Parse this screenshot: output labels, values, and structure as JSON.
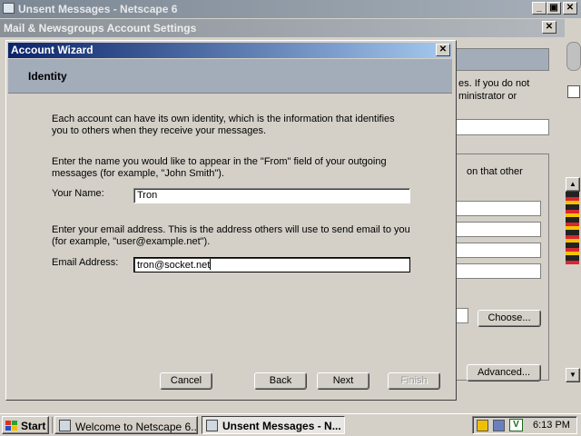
{
  "netscape_window": {
    "title": "Unsent Messages - Netscape 6",
    "controls": {
      "minimize": "_",
      "maximize": "▣",
      "close": "✕"
    }
  },
  "account_settings": {
    "title": "Mail & Newsgroups Account Settings",
    "close": "✕",
    "fragments": {
      "line1": "es. If you do not",
      "line2": "ministrator or",
      "line3": "on that other"
    },
    "choose_button": "Choose...",
    "advanced_button": "Advanced..."
  },
  "wizard": {
    "title": "Account Wizard",
    "close": "✕",
    "header": "Identity",
    "intro_line1": "Each account can have its own identity, which is the information that identifies",
    "intro_line2": "you to others when they receive your messages.",
    "name_help_line1": "Enter the name you would like to appear in the \"From\" field of your outgoing",
    "name_help_line2": "messages (for example, \"John Smith\").",
    "name_label": "Your Name:",
    "name_value": "Tron",
    "email_help_line1": "Enter your email address. This is the address others will use to send email to you",
    "email_help_line2": "(for example, \"user@example.net\").",
    "email_label": "Email Address:",
    "email_value": "tron@socket.net",
    "buttons": {
      "cancel": "Cancel",
      "back": "Back",
      "next": "Next",
      "finish": "Finish"
    }
  },
  "taskbar": {
    "start": "Start",
    "tasks": [
      {
        "label": "Welcome to Netscape 6....",
        "active": false
      },
      {
        "label": "Unsent Messages - N...",
        "active": true
      }
    ],
    "clock": "6:13 PM"
  },
  "colors": {
    "desktop": "#3a6ea5",
    "wizard_title_start": "#0a246a",
    "wizard_title_end": "#a6caf0",
    "header_band": "#a3acb9"
  }
}
